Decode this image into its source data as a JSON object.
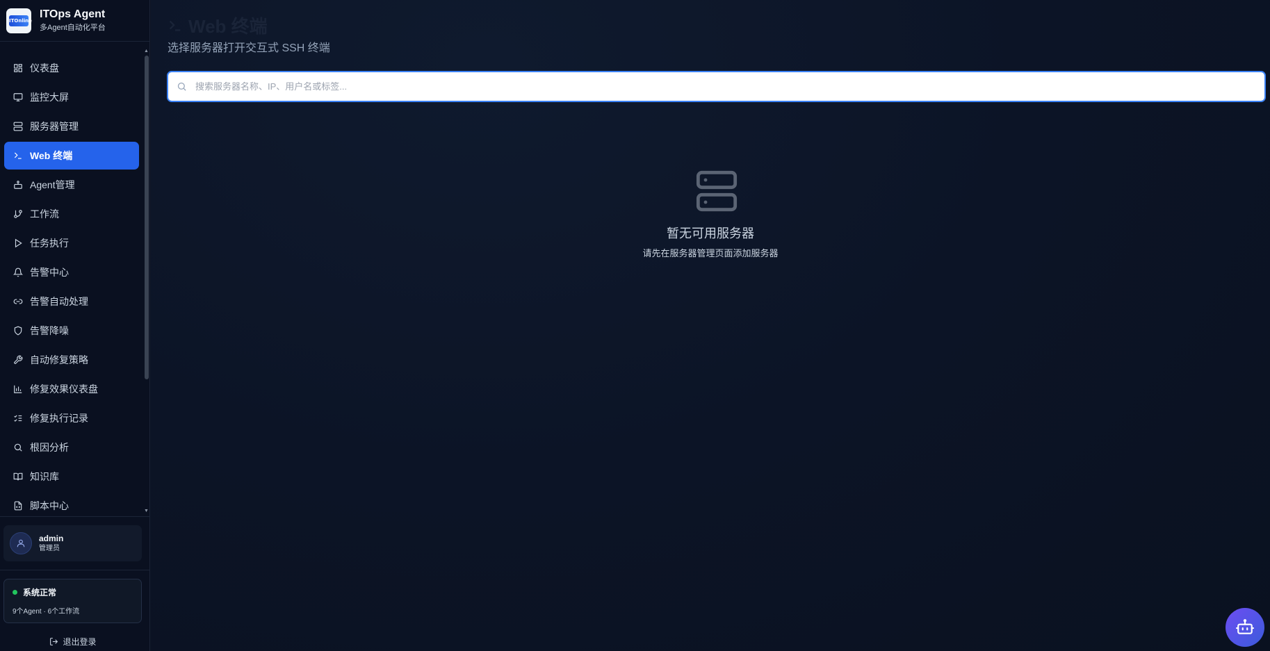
{
  "brand": {
    "title": "ITOps Agent",
    "subtitle": "多Agent自动化平台",
    "logo_text": "ITOnline"
  },
  "sidebar": {
    "items": [
      {
        "label": "仪表盘",
        "icon": "dashboard-icon"
      },
      {
        "label": "监控大屏",
        "icon": "monitor-icon"
      },
      {
        "label": "服务器管理",
        "icon": "server-icon"
      },
      {
        "label": "Web 终端",
        "icon": "terminal-icon",
        "active": true
      },
      {
        "label": "Agent管理",
        "icon": "bot-icon"
      },
      {
        "label": "工作流",
        "icon": "git-branch-icon"
      },
      {
        "label": "任务执行",
        "icon": "play-icon"
      },
      {
        "label": "告警中心",
        "icon": "bell-icon"
      },
      {
        "label": "告警自动处理",
        "icon": "link-icon"
      },
      {
        "label": "告警降噪",
        "icon": "shield-icon"
      },
      {
        "label": "自动修复策略",
        "icon": "wrench-icon"
      },
      {
        "label": "修复效果仪表盘",
        "icon": "bar-chart-icon"
      },
      {
        "label": "修复执行记录",
        "icon": "list-checks-icon"
      },
      {
        "label": "根因分析",
        "icon": "search-icon"
      },
      {
        "label": "知识库",
        "icon": "book-icon"
      },
      {
        "label": "脚本中心",
        "icon": "file-code-icon"
      }
    ]
  },
  "user": {
    "name": "admin",
    "role": "管理员"
  },
  "status": {
    "title": "系统正常",
    "detail": "9个Agent · 6个工作流",
    "color": "#22c55e"
  },
  "logout_label": "退出登录",
  "page": {
    "title": "Web 终端",
    "subtitle": "选择服务器打开交互式 SSH 终端",
    "search_placeholder": "搜索服务器名称、IP、用户名或标签...",
    "empty_title": "暂无可用服务器",
    "empty_subtitle": "请先在服务器管理页面添加服务器"
  },
  "colors": {
    "accent": "#2563eb",
    "background": "#0b1222"
  }
}
